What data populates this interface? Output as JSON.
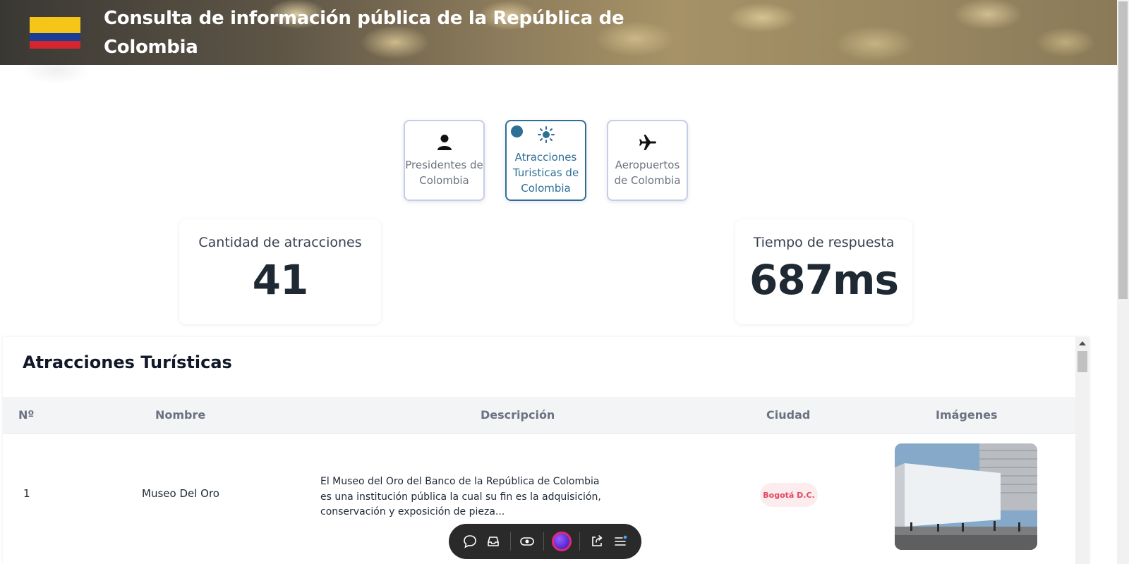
{
  "header": {
    "title": "Consulta de información pública de la República de Colombia",
    "flag_colors": [
      "#f5c518",
      "#1c3d96",
      "#d4262e"
    ]
  },
  "tabs": [
    {
      "label": "Presidentes de Colombia",
      "icon": "person-icon",
      "active": false
    },
    {
      "label": "Atracciones Turisticas de Colombia",
      "icon": "sun-icon",
      "active": true
    },
    {
      "label": "Aeropuertos de Colombia",
      "icon": "airplane-icon",
      "active": false
    }
  ],
  "stats": {
    "count": {
      "label": "Cantidad de atracciones",
      "value": "41"
    },
    "response": {
      "label": "Tiempo de respuesta",
      "value": "687ms"
    }
  },
  "table": {
    "title": "Atracciones Turísticas",
    "headers": [
      "Nº",
      "Nombre",
      "Descripción",
      "Ciudad",
      "Imágenes"
    ],
    "rows": [
      {
        "num": "1",
        "name": "Museo Del Oro",
        "description": "El Museo del Oro del Banco de la República de Colombia es una institución pública la cual su fin es la adquisición, conservación y exposición de pieza...",
        "city": "Bogotá D.C.",
        "image": "museo-del-oro-photo"
      }
    ]
  },
  "toolbar": {
    "icons": [
      "comment-icon",
      "inbox-icon",
      "eye-icon",
      "avatar",
      "share-icon",
      "menu-icon"
    ]
  },
  "colors": {
    "accent": "#2f6f95",
    "badge_bg": "#fdecee",
    "badge_text": "#e0485f"
  }
}
